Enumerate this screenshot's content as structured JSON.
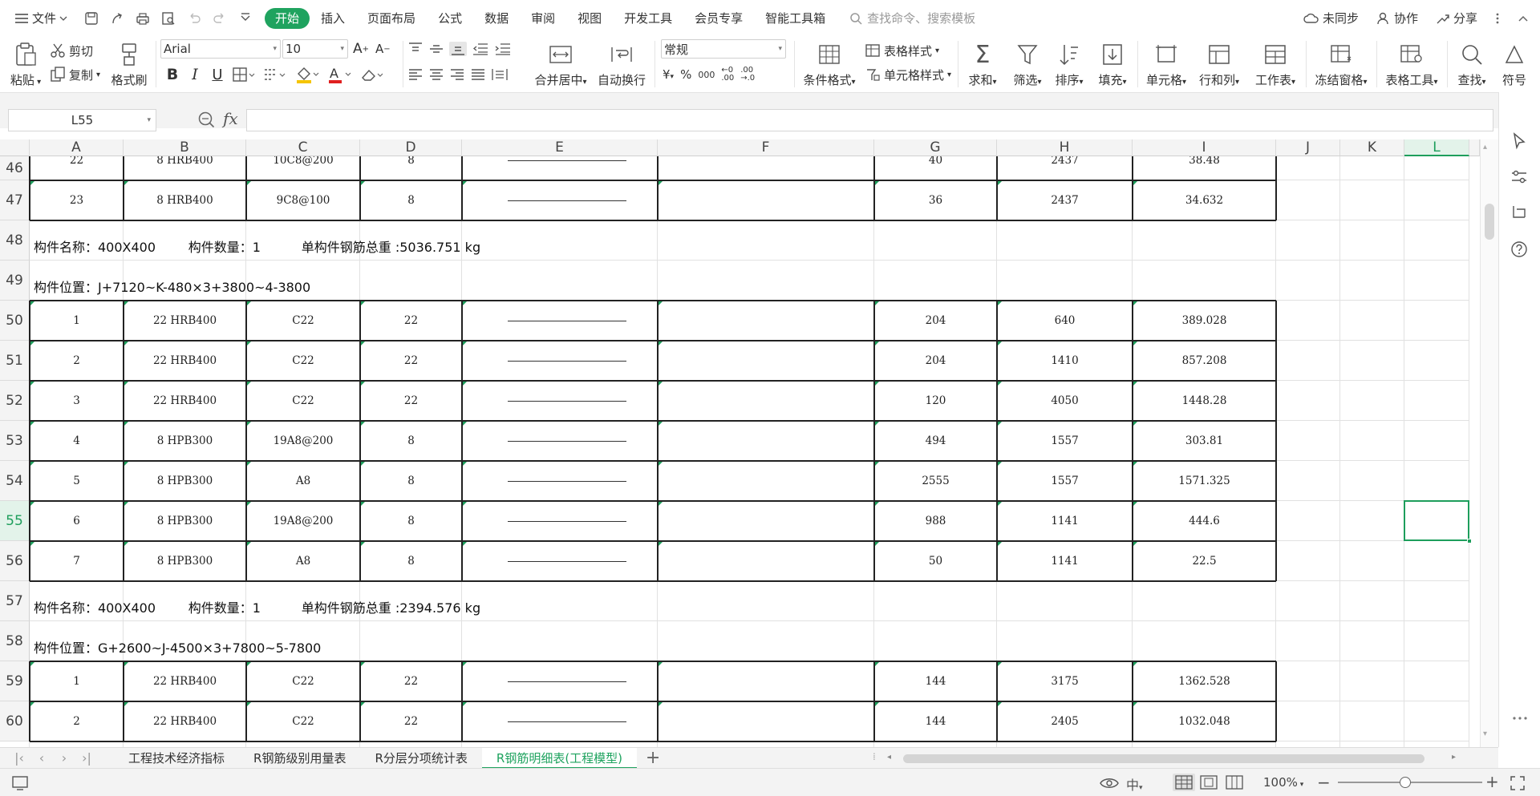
{
  "menubar": {
    "file_label": "文件",
    "tabs": [
      "开始",
      "插入",
      "页面布局",
      "公式",
      "数据",
      "审阅",
      "视图",
      "开发工具",
      "会员专享",
      "智能工具箱"
    ],
    "active_tab": 0,
    "search_placeholder": "查找命令、搜索模板",
    "sync_label": "未同步",
    "collab_label": "协作",
    "share_label": "分享"
  },
  "ribbon": {
    "paste": "粘贴",
    "cut": "剪切",
    "copy": "复制",
    "format_painter": "格式刷",
    "font_name": "Arial",
    "font_size": "10",
    "number_format": "常规",
    "merge_center": "合并居中",
    "wrap_text": "自动换行",
    "conditional_format": "条件格式",
    "table_style": "表格样式",
    "cell_style": "单元格样式",
    "sum": "求和",
    "filter": "筛选",
    "sort": "排序",
    "fill": "填充",
    "cell": "单元格",
    "row_col": "行和列",
    "worksheet": "工作表",
    "freeze": "冻结窗格",
    "table_tools": "表格工具",
    "find": "查找",
    "symbol": "符号"
  },
  "formula_bar": {
    "name_box": "L55",
    "fx": "fx",
    "content": ""
  },
  "grid": {
    "columns": [
      "A",
      "B",
      "C",
      "D",
      "E",
      "F",
      "G",
      "H",
      "I",
      "J",
      "K",
      "L"
    ],
    "selected_column": "L",
    "selected_row": "55",
    "rows": [
      {
        "num": "46",
        "type": "data",
        "cells": [
          "22",
          "8 HRB400",
          "10C8@200",
          "8",
          "",
          "",
          "40",
          "2437",
          "38.48"
        ]
      },
      {
        "num": "47",
        "type": "data",
        "cells": [
          "23",
          "8 HRB400",
          "9C8@100",
          "8",
          "",
          "",
          "36",
          "2437",
          "34.632"
        ]
      },
      {
        "num": "48",
        "type": "info",
        "text": "构件名称：400X400        构件数量：1          单构件钢筋总重 :5036.751 kg"
      },
      {
        "num": "49",
        "type": "info",
        "text": "构件位置：J+7120~K-480×3+3800~4-3800"
      },
      {
        "num": "50",
        "type": "data",
        "cells": [
          "1",
          "22 HRB400",
          "C22",
          "22",
          "",
          "",
          "204",
          "640",
          "389.028"
        ]
      },
      {
        "num": "51",
        "type": "data",
        "cells": [
          "2",
          "22 HRB400",
          "C22",
          "22",
          "",
          "",
          "204",
          "1410",
          "857.208"
        ]
      },
      {
        "num": "52",
        "type": "data",
        "cells": [
          "3",
          "22 HRB400",
          "C22",
          "22",
          "",
          "",
          "120",
          "4050",
          "1448.28"
        ]
      },
      {
        "num": "53",
        "type": "data",
        "cells": [
          "4",
          "8 HPB300",
          "19A8@200",
          "8",
          "",
          "",
          "494",
          "1557",
          "303.81"
        ]
      },
      {
        "num": "54",
        "type": "data",
        "cells": [
          "5",
          "8 HPB300",
          "A8",
          "8",
          "",
          "",
          "2555",
          "1557",
          "1571.325"
        ]
      },
      {
        "num": "55",
        "type": "data",
        "cells": [
          "6",
          "8 HPB300",
          "19A8@200",
          "8",
          "",
          "",
          "988",
          "1141",
          "444.6"
        ]
      },
      {
        "num": "56",
        "type": "data",
        "cells": [
          "7",
          "8 HPB300",
          "A8",
          "8",
          "",
          "",
          "50",
          "1141",
          "22.5"
        ]
      },
      {
        "num": "57",
        "type": "info",
        "text": "构件名称：400X400        构件数量：1          单构件钢筋总重 :2394.576 kg"
      },
      {
        "num": "58",
        "type": "info",
        "text": "构件位置：G+2600~J-4500×3+7800~5-7800"
      },
      {
        "num": "59",
        "type": "data",
        "cells": [
          "1",
          "22 HRB400",
          "C22",
          "22",
          "",
          "",
          "144",
          "3175",
          "1362.528"
        ]
      },
      {
        "num": "60",
        "type": "data",
        "cells": [
          "2",
          "22 HRB400",
          "C22",
          "22",
          "",
          "",
          "144",
          "2405",
          "1032.048"
        ]
      }
    ]
  },
  "sheets": {
    "tabs": [
      "工程技术经济指标",
      "R钢筋级别用量表",
      "R分层分项统计表",
      "R钢筋明细表(工程模型)"
    ],
    "active": 3,
    "add": "+"
  },
  "status": {
    "zoom": "100%"
  },
  "colors": {
    "accent": "#1fa35f",
    "selection": "#1e9e5c"
  }
}
